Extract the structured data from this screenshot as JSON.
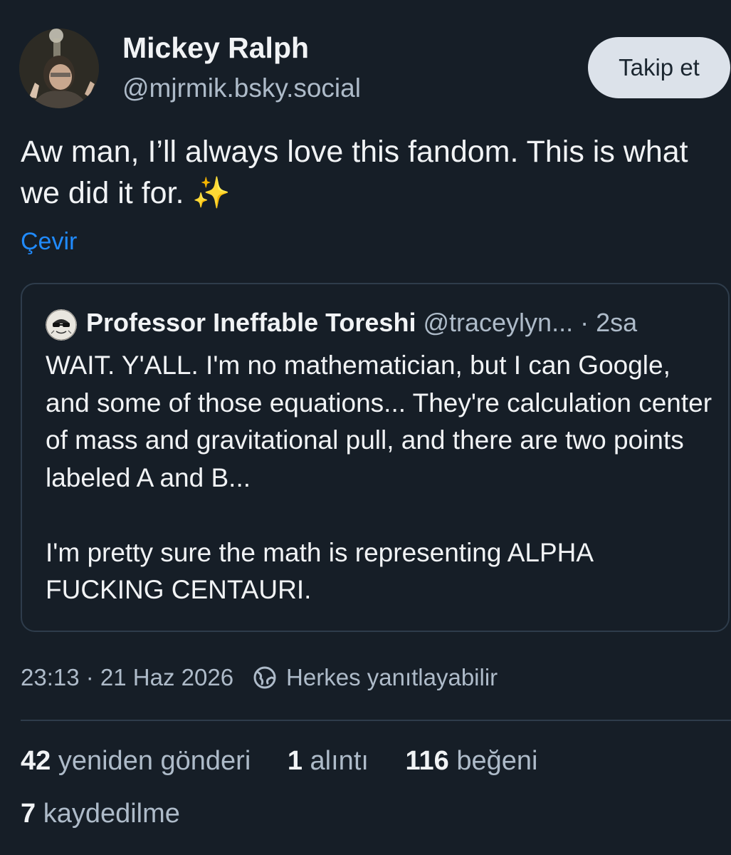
{
  "author": {
    "name": "Mickey Ralph",
    "handle": "@mjrmik.bsky.social"
  },
  "follow_button": "Takip et",
  "post": {
    "text": "Aw man, I’ll always love this fandom. This is what we did it for. ✨",
    "translate_label": "Çevir"
  },
  "quote": {
    "author_name": "Professor Ineffable Toreshi",
    "author_handle": "@traceylyn...",
    "separator": "·",
    "time": "2sa",
    "paragraphs": [
      "WAIT. Y'ALL. I'm no mathematician, but I can Google, and some of those equations... They're calculation center of mass and gravitational pull, and there are two points labeled A and B...",
      "I'm pretty sure the math is representing ALPHA FUCKING CENTAURI."
    ]
  },
  "meta": {
    "timestamp": "23:13 · 21 Haz 2026",
    "reply_setting": "Herkes yanıtlayabilir",
    "icon": "globe-icon"
  },
  "stats": {
    "reposts": {
      "count": "42",
      "label": "yeniden gönderi"
    },
    "quotes": {
      "count": "1",
      "label": "alıntı"
    },
    "likes": {
      "count": "116",
      "label": "beğeni"
    },
    "saves": {
      "count": "7",
      "label": "kaydedilme"
    }
  },
  "colors": {
    "background": "#161e27",
    "text": "#f1f3f5",
    "muted": "#aebbc9",
    "link": "#208bfe",
    "border": "#2e3c4b",
    "button_bg": "#dce2ea"
  }
}
